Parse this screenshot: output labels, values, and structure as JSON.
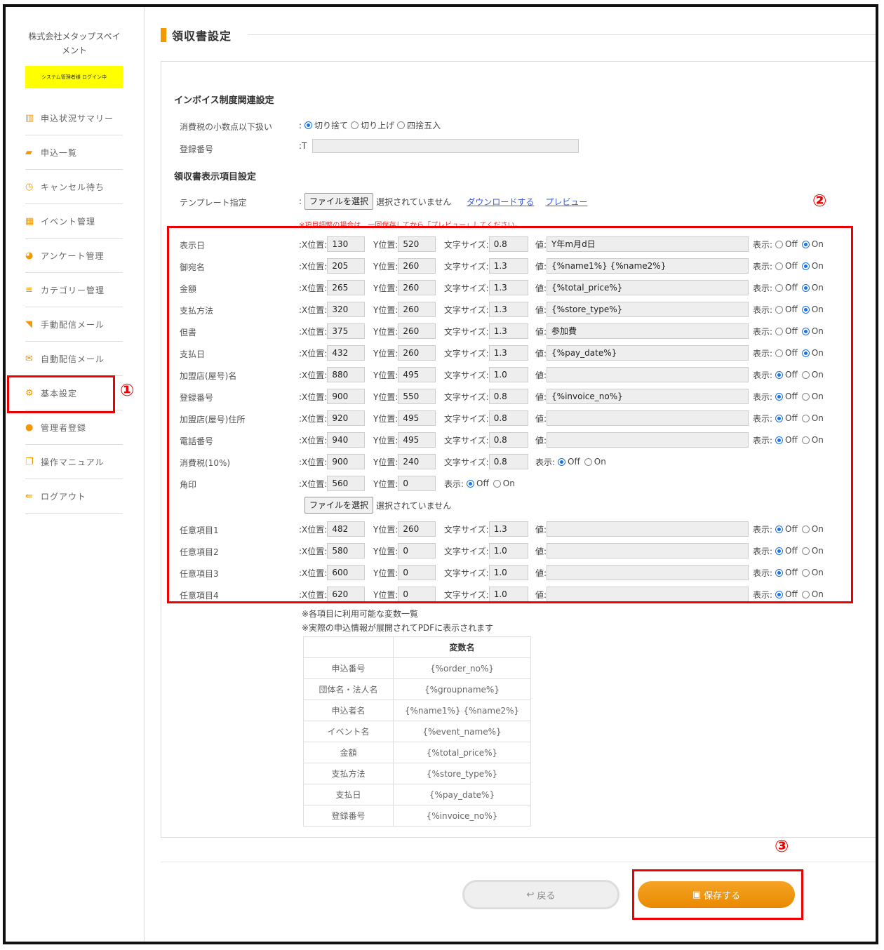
{
  "sidebar": {
    "company": "株式会社メタップスペイメント",
    "login_badge": "システム管理者様 ログイン中",
    "items": [
      {
        "label": "申込状況サマリー",
        "icon": "bar-chart-icon"
      },
      {
        "label": "申込一覧",
        "icon": "book-icon"
      },
      {
        "label": "キャンセル待ち",
        "icon": "clock-icon"
      },
      {
        "label": "イベント管理",
        "icon": "grid-icon"
      },
      {
        "label": "アンケート管理",
        "icon": "pie-chart-icon"
      },
      {
        "label": "カテゴリー管理",
        "icon": "list-icon"
      },
      {
        "label": "手動配信メール",
        "icon": "rss-icon"
      },
      {
        "label": "自動配信メール",
        "icon": "envelope-icon"
      },
      {
        "label": "基本設定",
        "icon": "gears-icon"
      },
      {
        "label": "管理者登録",
        "icon": "users-icon"
      },
      {
        "label": "操作マニュアル",
        "icon": "copy-icon"
      },
      {
        "label": "ログアウト",
        "icon": "sign-out-icon"
      }
    ]
  },
  "page": {
    "title": "領収書設定"
  },
  "invoice": {
    "heading": "インボイス制度関連設定",
    "tax_label": "消費税の小数点以下扱い",
    "tax_options": [
      "切り捨て",
      "切り上げ",
      "四捨五入"
    ],
    "reg_label": "登録番号",
    "reg_prefix": ":T",
    "reg_value": ""
  },
  "receipt": {
    "heading": "領収書表示項目設定",
    "template_label": "テンプレート指定",
    "file_button": "ファイルを選択",
    "no_file": "選択されていません",
    "download_link": "ダウンロードする",
    "preview_link": "プレビュー",
    "note": "※項目調整の場合は、一回保存してから「プレビュー」してください。"
  },
  "field_labels": {
    "x": ":X位置:",
    "y": "Y位置:",
    "size": "文字サイズ:",
    "value": "値:",
    "show": "表示:",
    "off": "Off",
    "on": "On"
  },
  "fields": [
    {
      "label": "表示日",
      "x": "130",
      "y": "520",
      "size": "0.8",
      "value": "Y年m月d日",
      "show": "On"
    },
    {
      "label": "御宛名",
      "x": "205",
      "y": "260",
      "size": "1.3",
      "value": "{%name1%} {%name2%}",
      "show": "On"
    },
    {
      "label": "金額",
      "x": "265",
      "y": "260",
      "size": "1.3",
      "value": "{%total_price%}",
      "show": "On"
    },
    {
      "label": "支払方法",
      "x": "320",
      "y": "260",
      "size": "1.3",
      "value": "{%store_type%}",
      "show": "On"
    },
    {
      "label": "但書",
      "x": "375",
      "y": "260",
      "size": "1.3",
      "value": "参加費",
      "show": "On"
    },
    {
      "label": "支払日",
      "x": "432",
      "y": "260",
      "size": "1.3",
      "value": "{%pay_date%}",
      "show": "On"
    },
    {
      "label": "加盟店(屋号)名",
      "x": "880",
      "y": "495",
      "size": "1.0",
      "value": "",
      "show": "Off"
    },
    {
      "label": "登録番号",
      "x": "900",
      "y": "550",
      "size": "0.8",
      "value": "{%invoice_no%}",
      "show": "Off"
    },
    {
      "label": "加盟店(屋号)住所",
      "x": "920",
      "y": "495",
      "size": "0.8",
      "value": "",
      "show": "Off"
    },
    {
      "label": "電話番号",
      "x": "940",
      "y": "495",
      "size": "0.8",
      "value": "",
      "show": "Off"
    }
  ],
  "tax_field": {
    "label": "消費税(10%)",
    "x": "900",
    "y": "240",
    "size": "0.8",
    "show": "Off"
  },
  "stamp_field": {
    "label": "角印",
    "x": "560",
    "y": "0",
    "show": "Off",
    "file_button": "ファイルを選択",
    "no_file": "選択されていません"
  },
  "optional_fields": [
    {
      "label": "任意項目1",
      "x": "482",
      "y": "260",
      "size": "1.3",
      "value": "",
      "show": "Off"
    },
    {
      "label": "任意項目2",
      "x": "580",
      "y": "0",
      "size": "1.0",
      "value": "",
      "show": "Off"
    },
    {
      "label": "任意項目3",
      "x": "600",
      "y": "0",
      "size": "1.0",
      "value": "",
      "show": "Off"
    },
    {
      "label": "任意項目4",
      "x": "620",
      "y": "0",
      "size": "1.0",
      "value": "",
      "show": "Off"
    }
  ],
  "variables": {
    "note1": "※各項目に利用可能な変数一覧",
    "note2": "※実際の申込情報が展開されてPDFに表示されます",
    "header": "変数名",
    "rows": [
      [
        "申込番号",
        "{%order_no%}"
      ],
      [
        "団体名・法人名",
        "{%groupname%}"
      ],
      [
        "申込者名",
        "{%name1%} {%name2%}"
      ],
      [
        "イベント名",
        "{%event_name%}"
      ],
      [
        "金額",
        "{%total_price%}"
      ],
      [
        "支払方法",
        "{%store_type%}"
      ],
      [
        "支払日",
        "{%pay_date%}"
      ],
      [
        "登録番号",
        "{%invoice_no%}"
      ]
    ]
  },
  "buttons": {
    "back": "戻る",
    "save": "保存する"
  },
  "markers": [
    "①",
    "②",
    "③"
  ],
  "colors": {
    "accent": "#f39800",
    "highlight": "#e00000",
    "badge": "#ffff00"
  }
}
